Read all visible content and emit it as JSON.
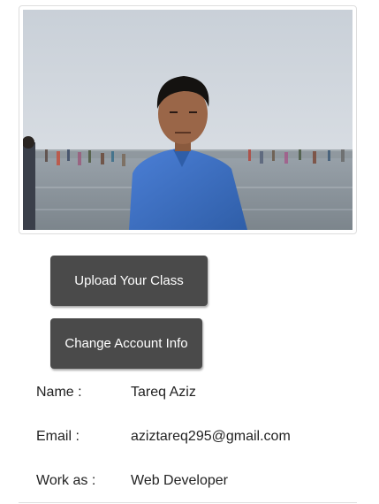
{
  "profile": {
    "photo_description_icon": "profile-photo",
    "upload_button_label": "Upload Your Class",
    "account_button_label": "Change Account Info"
  },
  "info": {
    "name_label": "Name :",
    "name_value": "Tareq Aziz",
    "email_label": "Email :",
    "email_value": "aziztareq295@gmail.com",
    "work_label": "Work as :",
    "work_value": "Web Developer"
  },
  "colors": {
    "button_bg": "#4a4a4a",
    "button_text": "#ffffff",
    "shirt": "#3d6fc4"
  }
}
